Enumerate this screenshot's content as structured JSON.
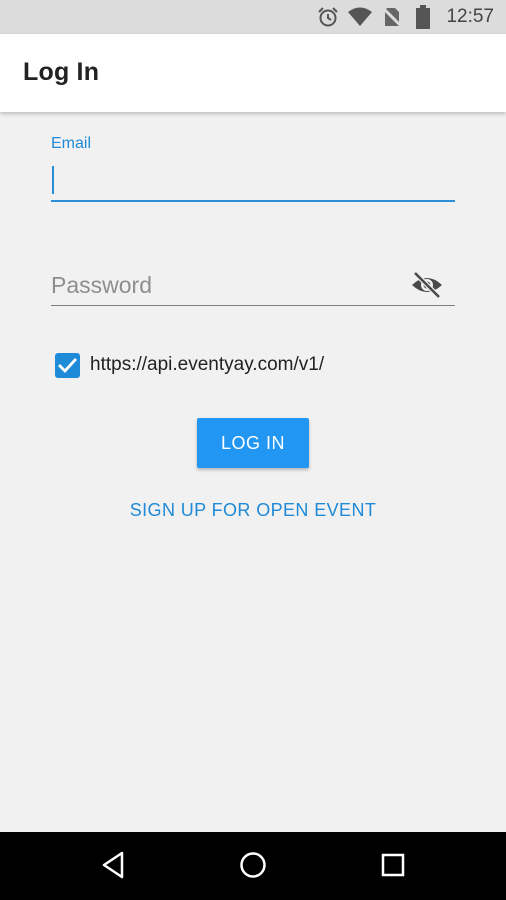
{
  "status_bar": {
    "time": "12:57",
    "icons": [
      "alarm-icon",
      "wifi-icon",
      "no-sim-icon",
      "battery-icon"
    ]
  },
  "app_bar": {
    "title": "Log In"
  },
  "form": {
    "email": {
      "label": "Email",
      "value": ""
    },
    "password": {
      "placeholder": "Password",
      "value": ""
    },
    "server": {
      "checked": true,
      "url": "https://api.eventyay.com/v1/"
    },
    "login_button": "LOG IN",
    "signup_link": "SIGN UP FOR OPEN EVENT"
  },
  "colors": {
    "accent": "#1f8ad7",
    "button": "#2196f3",
    "background": "#f1f1f1"
  },
  "nav_bar": {
    "icons": [
      "back-icon",
      "home-icon",
      "recents-icon"
    ]
  }
}
